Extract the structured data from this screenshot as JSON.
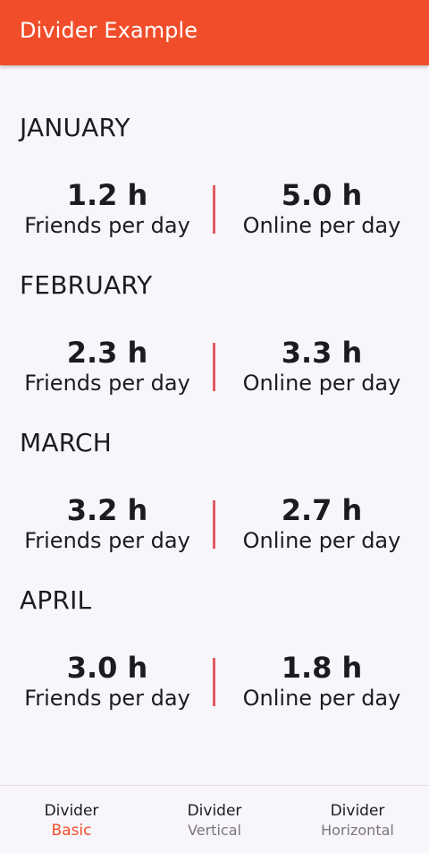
{
  "app_bar": {
    "title": "Divider Example"
  },
  "colors": {
    "accent": "#f24d2a",
    "divider": "#e05a63",
    "background": "#f8f6fa"
  },
  "months": [
    {
      "name": "JANUARY",
      "friends_value": "1.2 h",
      "friends_label": "Friends per day",
      "online_value": "5.0 h",
      "online_label": "Online per day"
    },
    {
      "name": "FEBRUARY",
      "friends_value": "2.3 h",
      "friends_label": "Friends per day",
      "online_value": "3.3 h",
      "online_label": "Online per day"
    },
    {
      "name": "MARCH",
      "friends_value": "3.2 h",
      "friends_label": "Friends per day",
      "online_value": "2.7 h",
      "online_label": "Online per day"
    },
    {
      "name": "APRIL",
      "friends_value": "3.0 h",
      "friends_label": "Friends per day",
      "online_value": "1.8 h",
      "online_label": "Online per day"
    }
  ],
  "bottom_nav": {
    "items": [
      {
        "title": "Divider",
        "subtitle": "Basic",
        "active": true
      },
      {
        "title": "Divider",
        "subtitle": "Vertical",
        "active": false
      },
      {
        "title": "Divider",
        "subtitle": "Horizontal",
        "active": false
      }
    ]
  }
}
